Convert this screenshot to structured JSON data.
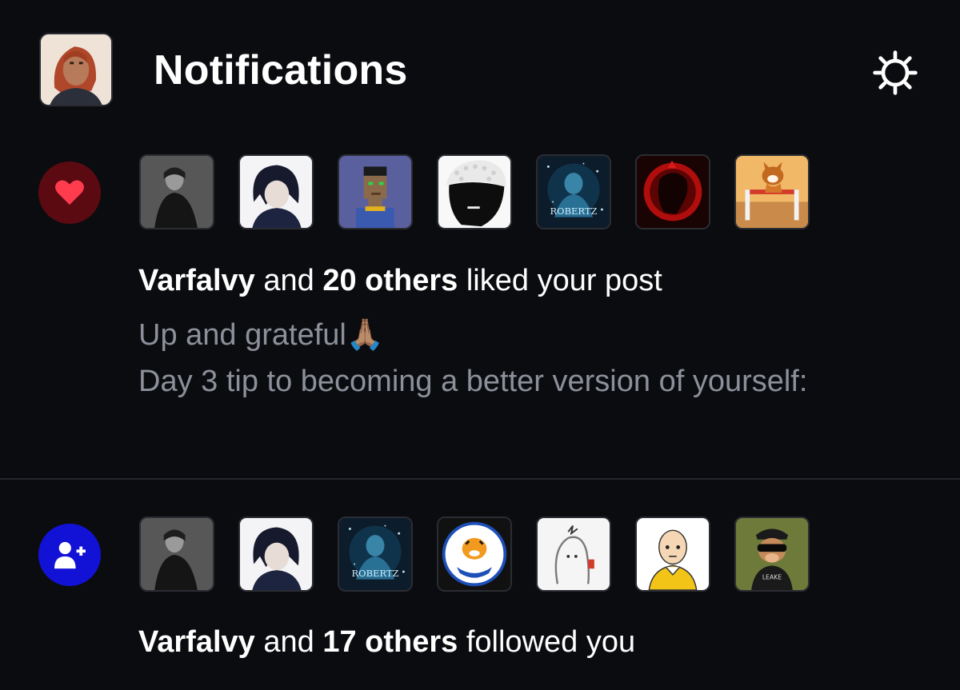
{
  "header": {
    "title": "Notifications",
    "settings_icon": "gear-icon"
  },
  "notifications": [
    {
      "type": "like",
      "type_icon": "heart-icon",
      "icon_color": "#ff3b4e",
      "icon_bg": "#5c0a12",
      "summary": {
        "actor": "Varfalvy",
        "connector": " and ",
        "others": "20 others",
        "action": " liked your post"
      },
      "preview_lines": [
        "Up and grateful🙏🏽",
        "Day 3 tip to becoming a better version of yourself:"
      ],
      "avatars": [
        "man-portrait",
        "anime-boy",
        "pixel-punk",
        "pearl-hat-woman",
        "robertz-galaxy",
        "red-helmet",
        "dog-hurdle"
      ]
    },
    {
      "type": "follow",
      "type_icon": "add-user-icon",
      "icon_color": "#ffffff",
      "icon_bg": "#1212d6",
      "summary": {
        "actor": "Varfalvy",
        "connector": " and ",
        "others": "17 others",
        "action": " followed you"
      },
      "avatars": [
        "man-portrait",
        "anime-boy",
        "robertz-galaxy",
        "easy-tiger-logo",
        "doodle-character",
        "bald-hero",
        "monkey-sunglasses"
      ]
    }
  ]
}
